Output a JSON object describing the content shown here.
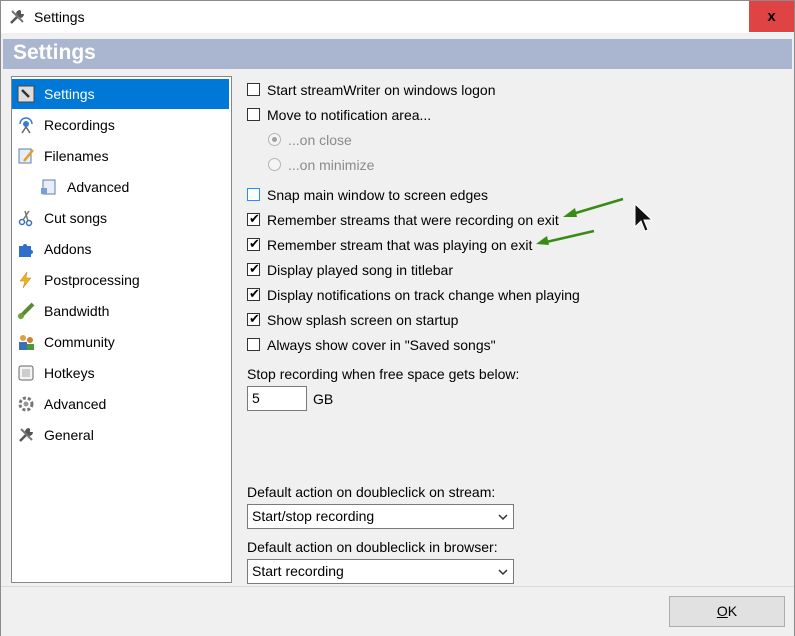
{
  "window": {
    "title": "Settings",
    "close_glyph": "x"
  },
  "header": {
    "title": "Settings"
  },
  "sidebar": {
    "items": [
      {
        "label": "Settings",
        "icon": "settings-icon",
        "selected": true
      },
      {
        "label": "Recordings",
        "icon": "recordings-icon"
      },
      {
        "label": "Filenames",
        "icon": "filenames-icon"
      },
      {
        "label": "Advanced",
        "icon": "advanced-file-icon",
        "child": true
      },
      {
        "label": "Cut songs",
        "icon": "scissors-icon"
      },
      {
        "label": "Addons",
        "icon": "puzzle-icon"
      },
      {
        "label": "Postprocessing",
        "icon": "lightning-icon"
      },
      {
        "label": "Bandwidth",
        "icon": "bandwidth-icon"
      },
      {
        "label": "Community",
        "icon": "community-icon"
      },
      {
        "label": "Hotkeys",
        "icon": "keyboard-icon"
      },
      {
        "label": "Advanced",
        "icon": "gear-icon"
      },
      {
        "label": "General",
        "icon": "tools-icon"
      }
    ]
  },
  "options": {
    "start_on_logon": {
      "label": "Start streamWriter on windows logon",
      "checked": false
    },
    "move_to_tray": {
      "label": "Move to notification area...",
      "checked": false
    },
    "on_close": {
      "label": "...on close",
      "selected": true,
      "disabled": true
    },
    "on_minimize": {
      "label": "...on minimize",
      "selected": false,
      "disabled": true
    },
    "snap_window": {
      "label": "Snap main window to screen edges",
      "checked": false
    },
    "remember_recording": {
      "label": "Remember streams that were recording on exit",
      "checked": true
    },
    "remember_playing": {
      "label": "Remember stream that was playing on exit",
      "checked": true
    },
    "display_song_titlebar": {
      "label": "Display played song in titlebar",
      "checked": true
    },
    "display_notifications": {
      "label": "Display notifications on track change when playing",
      "checked": true
    },
    "show_splash": {
      "label": "Show splash screen on startup",
      "checked": true
    },
    "always_show_cover": {
      "label": "Always show cover in \"Saved songs\"",
      "checked": false
    }
  },
  "free_space": {
    "label": "Stop recording when free space gets below:",
    "value": "5",
    "unit": "GB"
  },
  "stream_action": {
    "label": "Default action on doubleclick on stream:",
    "value": "Start/stop recording"
  },
  "browser_action": {
    "label": "Default action on doubleclick in browser:",
    "value": "Start recording"
  },
  "buttons": {
    "ok_underlined": "O",
    "ok_rest": "K"
  },
  "colors": {
    "accent": "#0078d7",
    "header_band": "#aab6cf",
    "close_red": "#e04343",
    "arrow_green": "#3a8a16"
  }
}
